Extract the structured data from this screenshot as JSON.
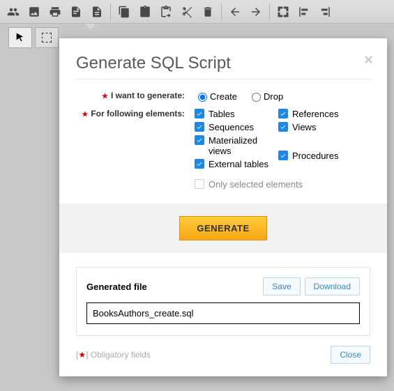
{
  "toolbar": {
    "icons": [
      "users",
      "image",
      "print",
      "sql",
      "doc",
      "copy",
      "paste",
      "paste-special",
      "cut",
      "trash",
      "undo",
      "redo",
      "expand",
      "align-left",
      "align-right"
    ]
  },
  "dialog": {
    "title": "Generate SQL Script",
    "section1_label": "I want to generate:",
    "radio_create": "Create",
    "radio_drop": "Drop",
    "section2_label": "For following elements:",
    "checks_left": [
      "Tables",
      "Sequences",
      "Materialized views",
      "External tables"
    ],
    "checks_right": [
      "References",
      "Views",
      "",
      "Procedures"
    ],
    "only_selected": "Only selected elements",
    "generate_btn": "GENERATE",
    "generated_file_label": "Generated file",
    "save_btn": "Save",
    "download_btn": "Download",
    "filename": "BooksAuthors_create.sql",
    "obligatory_prefix": "[",
    "obligatory_star": "★",
    "obligatory_suffix": "] Obligatory fields",
    "close_btn": "Close"
  }
}
